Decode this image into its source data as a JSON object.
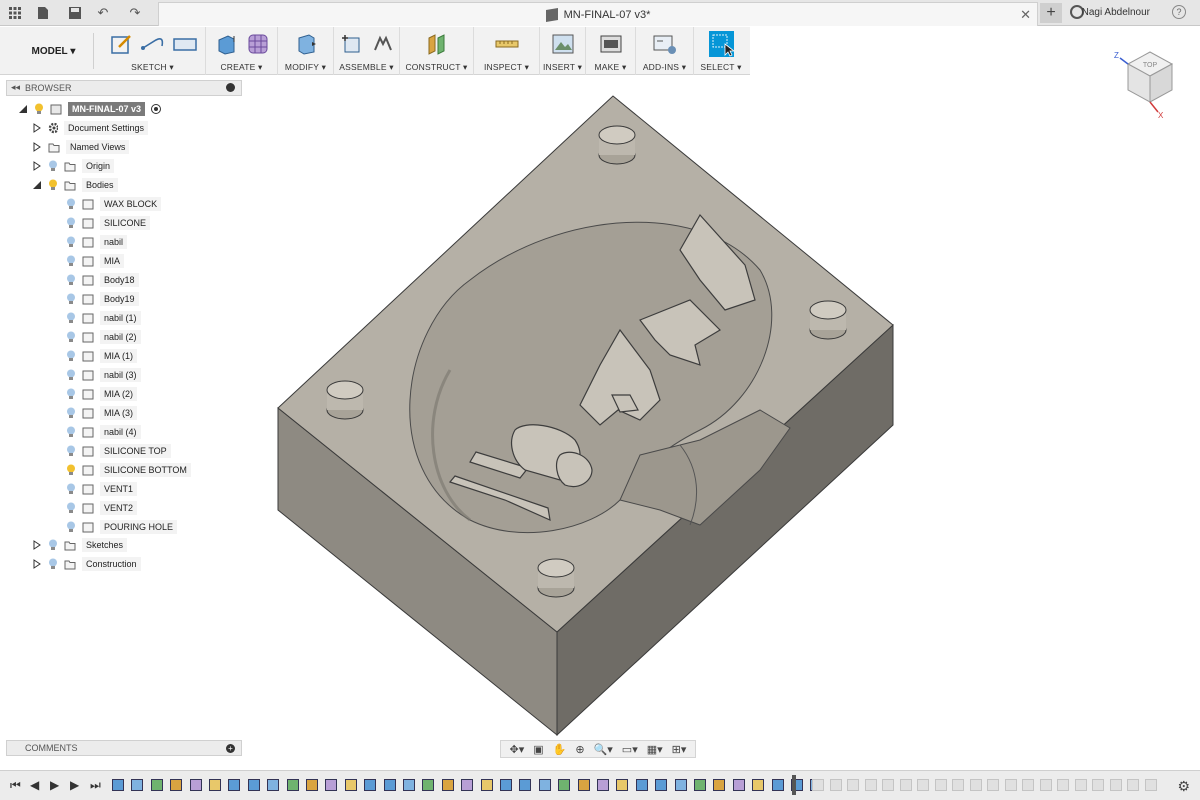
{
  "app": {
    "document_title": "MN-FINAL-07 v3*",
    "user_name": "Nagi Abdelnour",
    "help_label": "?"
  },
  "ribbon": {
    "model_label": "MODEL",
    "groups": [
      {
        "label": "SKETCH ▾"
      },
      {
        "label": "CREATE ▾"
      },
      {
        "label": "MODIFY ▾"
      },
      {
        "label": "ASSEMBLE ▾"
      },
      {
        "label": "CONSTRUCT ▾"
      },
      {
        "label": "INSPECT ▾"
      },
      {
        "label": "INSERT ▾"
      },
      {
        "label": "MAKE ▾"
      },
      {
        "label": "ADD-INS ▾"
      },
      {
        "label": "SELECT ▾"
      }
    ]
  },
  "browser": {
    "title": "BROWSER",
    "root": "MN-FINAL-07 v3",
    "items": {
      "document_settings": "Document Settings",
      "named_views": "Named Views",
      "origin": "Origin",
      "bodies": "Bodies",
      "sketches": "Sketches",
      "construction": "Construction"
    },
    "bodies": [
      "WAX BLOCK",
      "SILICONE",
      "nabil",
      "MIA",
      "Body18",
      "Body19",
      "nabil (1)",
      "nabil (2)",
      "MIA (1)",
      "nabil (3)",
      "MIA (2)",
      "MIA (3)",
      "nabil (4)",
      "SILICONE TOP",
      "SILICONE BOTTOM",
      "VENT1",
      "VENT2",
      "POURING HOLE"
    ]
  },
  "comments": {
    "title": "COMMENTS"
  },
  "viewcube": {
    "face_label": "TOP",
    "axis_x": "X",
    "axis_z": "Z"
  },
  "colors": {
    "accent": "#0696d7",
    "model_face": "#b5b0a6",
    "model_side": "#8e8a82",
    "model_dark": "#6f6c66"
  }
}
